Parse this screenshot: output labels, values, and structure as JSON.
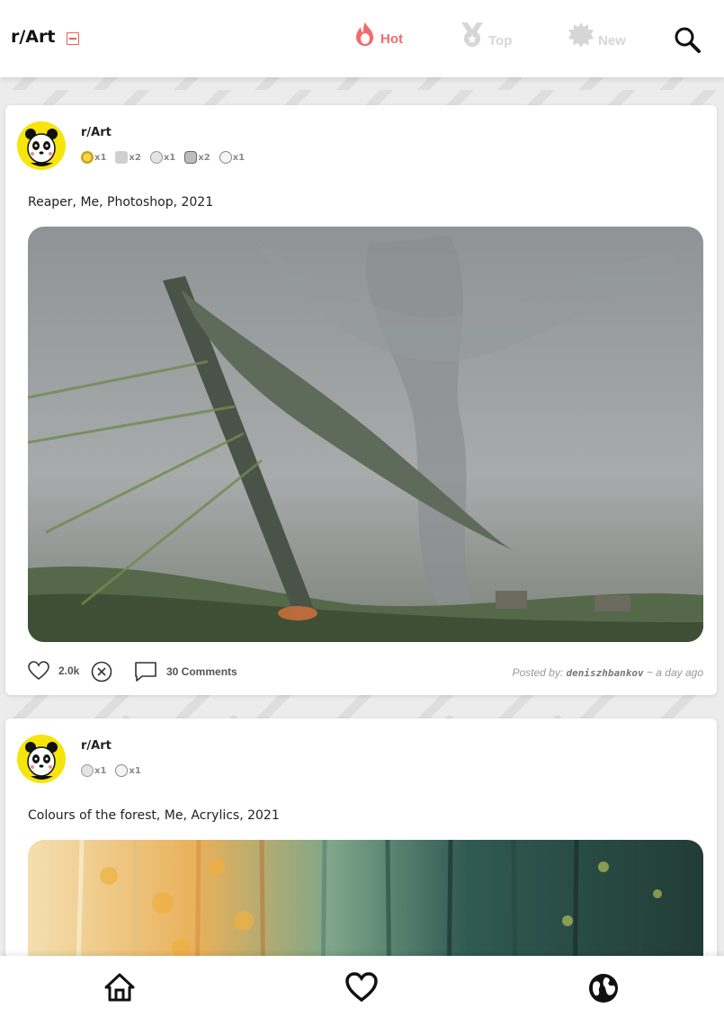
{
  "header": {
    "brand": "r/Art",
    "tabs": [
      {
        "label": "Hot",
        "icon": "flame-icon",
        "active": true
      },
      {
        "label": "Top",
        "icon": "medal-icon",
        "active": false
      },
      {
        "label": "New",
        "icon": "burst-icon",
        "active": false
      }
    ]
  },
  "colors": {
    "accent": "#f26b6b",
    "inactive": "#d6d6d6",
    "avatar_bg": "#f6e50b"
  },
  "posts": [
    {
      "subreddit": "r/Art",
      "awards": [
        {
          "icon": "gold-award-icon",
          "count": "x1"
        },
        {
          "icon": "wholesome-award-icon",
          "count": "x2"
        },
        {
          "icon": "helpful-award-icon",
          "count": "x1"
        },
        {
          "icon": "silver-award-icon",
          "count": "x2"
        },
        {
          "icon": "snoo-award-icon",
          "count": "x1"
        }
      ],
      "title": "Reaper, Me, Photoshop, 2021",
      "likes": "2.0k",
      "comments": "30 Comments",
      "posted_prefix": "Posted by:",
      "author": "deniszhbankov",
      "time": "~ a day ago"
    },
    {
      "subreddit": "r/Art",
      "awards": [
        {
          "icon": "helpful-award-icon",
          "count": "x1"
        },
        {
          "icon": "snoo-award-icon",
          "count": "x1"
        }
      ],
      "title": "Colours of the forest, Me, Acrylics, 2021"
    }
  ],
  "bottom_nav": [
    {
      "icon": "home-icon"
    },
    {
      "icon": "heart-icon"
    },
    {
      "icon": "globe-icon"
    }
  ]
}
